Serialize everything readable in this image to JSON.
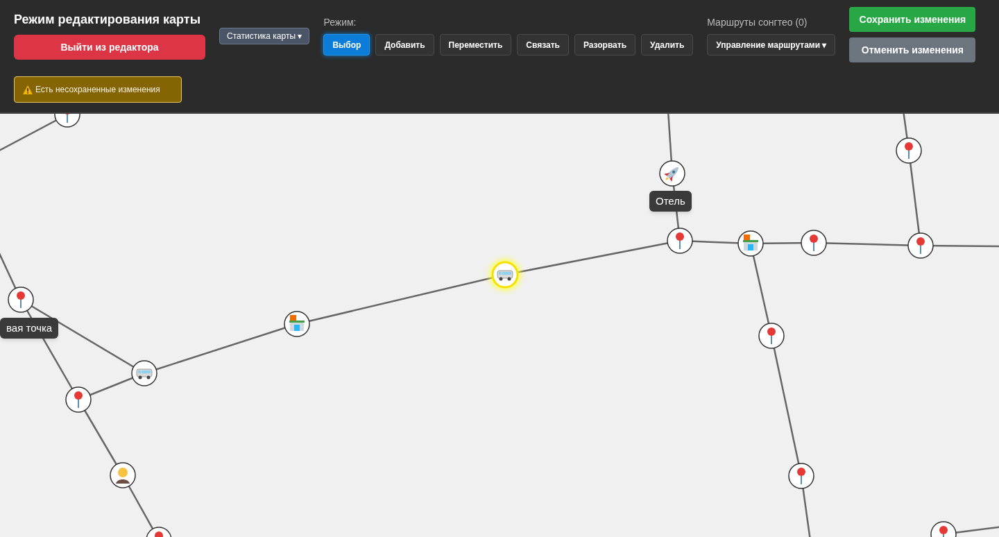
{
  "header": {
    "title": "Режим редактирования карты",
    "exit_button": "Выйти из редактора",
    "warning": "Есть несохраненные изменения",
    "stats_button": "Статистика карты ▾",
    "mode_label": "Режим:",
    "modes": [
      {
        "label": "Выбор",
        "selected": true
      },
      {
        "label": "Добавить",
        "selected": false
      },
      {
        "label": "Переместить",
        "selected": false
      },
      {
        "label": "Связать",
        "selected": false
      },
      {
        "label": "Разорвать",
        "selected": false
      },
      {
        "label": "Удалить",
        "selected": false
      }
    ],
    "routes_label": "Маршруты сонгтео (0)",
    "routes_button": "Управление маршрутами ▾",
    "save_button": "Сохранить изменения",
    "cancel_button": "Отменить изменения"
  },
  "map": {
    "nodes": [
      {
        "kind": "pin",
        "selected": false
      },
      {
        "kind": "pin",
        "selected": false,
        "label": "вая точка"
      },
      {
        "kind": "van",
        "selected": false
      },
      {
        "kind": "pin",
        "selected": false
      },
      {
        "kind": "person",
        "selected": false
      },
      {
        "kind": "pin",
        "selected": false
      },
      {
        "kind": "store",
        "selected": false
      },
      {
        "kind": "van",
        "selected": true
      },
      {
        "kind": "rocket",
        "selected": false,
        "label": "Отель"
      },
      {
        "kind": "pin",
        "selected": false
      },
      {
        "kind": "store",
        "selected": false
      },
      {
        "kind": "pin",
        "selected": false
      },
      {
        "kind": "pin",
        "selected": false
      },
      {
        "kind": "pin",
        "selected": false
      },
      {
        "kind": "pin",
        "selected": false
      },
      {
        "kind": "pin",
        "selected": false
      },
      {
        "kind": "pin",
        "selected": false
      }
    ]
  }
}
